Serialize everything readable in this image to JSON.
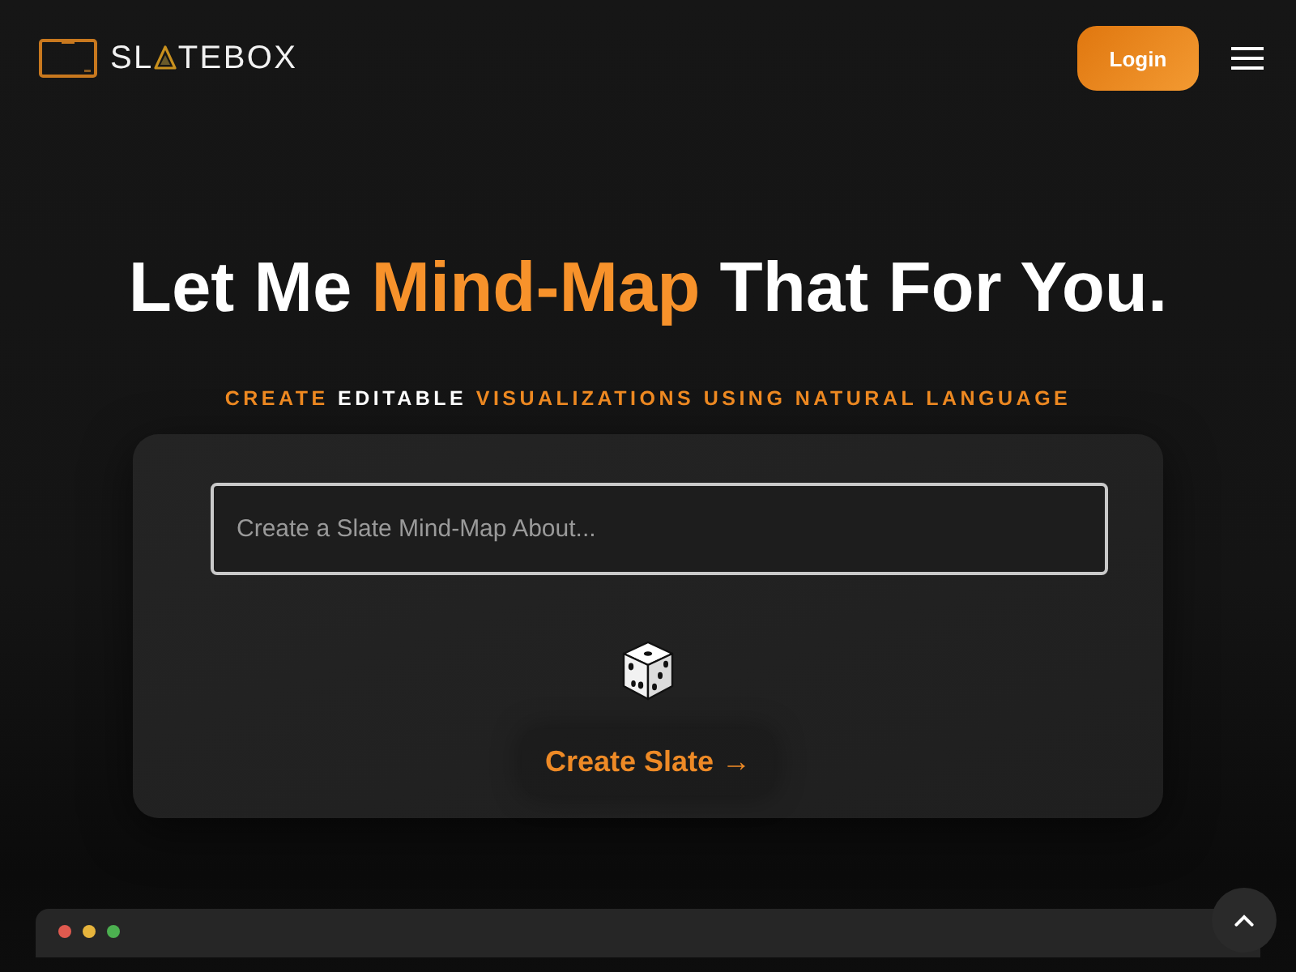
{
  "header": {
    "logo": {
      "wordmark": [
        "SL",
        "TEBOX"
      ]
    },
    "login_button": "Login"
  },
  "hero": {
    "title": [
      {
        "text": "Let Me",
        "accent": false
      },
      {
        "text": "Mind-Map",
        "accent": true
      },
      {
        "text": "That For You.",
        "accent": false
      }
    ],
    "tagline": [
      {
        "text": "CREATE",
        "accent": true
      },
      {
        "text": "EDITABLE",
        "accent": false
      },
      {
        "text": "VISUALIZATIONS USING NATURAL LANGUAGE",
        "accent": true
      }
    ]
  },
  "prompt_card": {
    "input": {
      "placeholder": "Create a Slate Mind-Map About..."
    },
    "create_button": "Create Slate →"
  },
  "preview_window": {
    "dots": [
      {
        "color": "#e05a4f"
      },
      {
        "color": "#e6b43c"
      },
      {
        "color": "#4cb050"
      }
    ]
  }
}
